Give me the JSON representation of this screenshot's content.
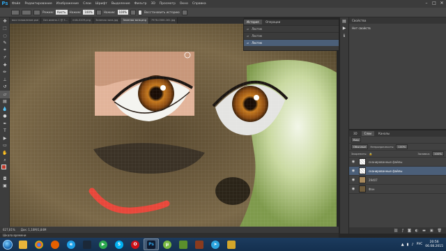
{
  "app": {
    "logo": "Ps"
  },
  "menu": [
    "Файл",
    "Редактирование",
    "Изображение",
    "Слои",
    "Шрифт",
    "Выделение",
    "Фильтр",
    "3D",
    "Просмотр",
    "Окно",
    "Справка"
  ],
  "options": {
    "mode_label": "Режим:",
    "mode_value": "Кисть",
    "opacity_label": "Нажим:",
    "opacity_value": "100%",
    "flow_label": "Нажим:",
    "flow_value": "100%",
    "restore_label": "Восстановить историю"
  },
  "doc_tabs": [
    "восстановление.psd",
    "Без имени-1 @ 5...",
    "milk-0209.png",
    "Зеленая зона.jpg",
    "Зеленая зона.png",
    "7978-0300-161.jpg"
  ],
  "history_panel": {
    "tabs": [
      "История",
      "Операции"
    ],
    "rows": [
      "Ластик",
      "Ластик",
      "Ластик"
    ]
  },
  "properties_panel": {
    "title": "Свойства",
    "body": "Нет свойств"
  },
  "layers_panel": {
    "tabs": [
      "3D",
      "Слои",
      "Каналы"
    ],
    "filter": "Вид",
    "blend_mode": "Обычные",
    "opacity_label": "Непрозрачность:",
    "opacity_value": "100%",
    "lock_label": "Закрепить:",
    "fill_label": "Заливка:",
    "fill_value": "100%",
    "layers": [
      {
        "name": "сканированные файлы",
        "selected": false
      },
      {
        "name": "сканированные файлы",
        "selected": true
      },
      {
        "name": "29407",
        "selected": false
      },
      {
        "name": "Фон",
        "selected": false
      }
    ]
  },
  "status": {
    "zoom": "627,81%",
    "doc": "Док: 1,10M/1,84M",
    "minibridge": "Шкала времени"
  },
  "taskbar": {
    "apps": [
      "explorer",
      "chrome",
      "firefox",
      "ie",
      "steam",
      "media",
      "skype",
      "opera",
      "photoshop",
      "utorrent",
      "minecraft",
      "game",
      "telegram",
      "folder"
    ],
    "lang": "РУС",
    "time": "20:56",
    "date": "06.08.2015"
  },
  "colors": {
    "accent": "#4b5f79",
    "brush_stroke": "#e8473a"
  }
}
